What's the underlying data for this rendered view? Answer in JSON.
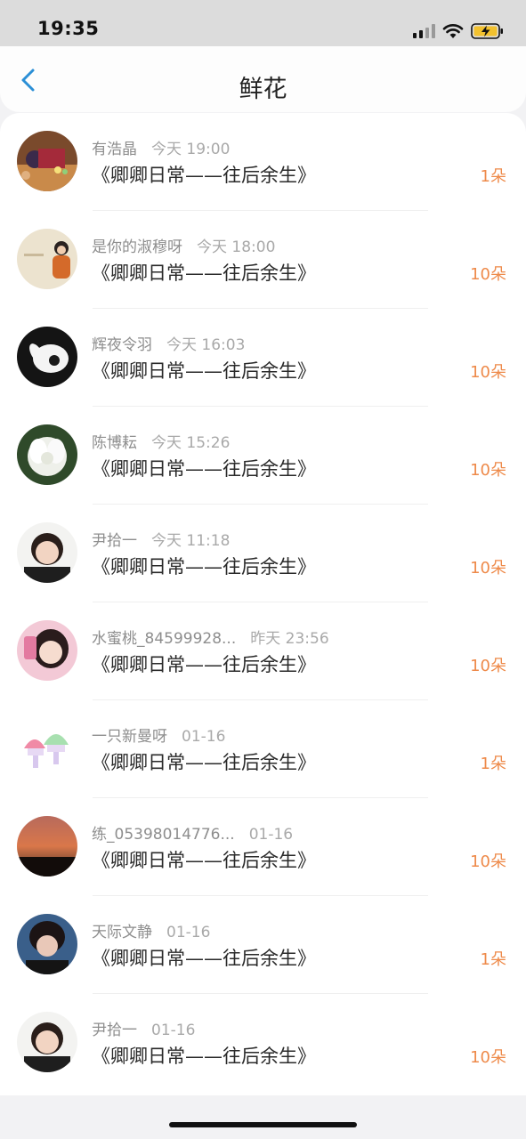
{
  "status_bar": {
    "time": "19:35"
  },
  "header": {
    "title": "鲜花"
  },
  "items": [
    {
      "name": "有浩晶",
      "time": "今天 19:00",
      "book": "《卿卿日常——往后余生》",
      "count": "1朵"
    },
    {
      "name": "是你的淑穆呀",
      "time": "今天 18:00",
      "book": "《卿卿日常——往后余生》",
      "count": "10朵"
    },
    {
      "name": "辉夜令羽",
      "time": "今天 16:03",
      "book": "《卿卿日常——往后余生》",
      "count": "10朵"
    },
    {
      "name": "陈博耘",
      "time": "今天 15:26",
      "book": "《卿卿日常——往后余生》",
      "count": "10朵"
    },
    {
      "name": "尹拾一",
      "time": "今天 11:18",
      "book": "《卿卿日常——往后余生》",
      "count": "10朵"
    },
    {
      "name": "水蜜桃_84599928...",
      "time": "昨天 23:56",
      "book": "《卿卿日常——往后余生》",
      "count": "10朵"
    },
    {
      "name": "一只新曼呀",
      "time": "01-16",
      "book": "《卿卿日常——往后余生》",
      "count": "1朵"
    },
    {
      "name": "练_05398014776...",
      "time": "01-16",
      "book": "《卿卿日常——往后余生》",
      "count": "10朵"
    },
    {
      "name": "天际文静",
      "time": "01-16",
      "book": "《卿卿日常——往后余生》",
      "count": "1朵"
    },
    {
      "name": "尹拾一",
      "time": "01-16",
      "book": "《卿卿日常——往后余生》",
      "count": "10朵"
    }
  ],
  "colors": {
    "accent": "#ee8a4a",
    "back_arrow": "#2b8fd6"
  }
}
